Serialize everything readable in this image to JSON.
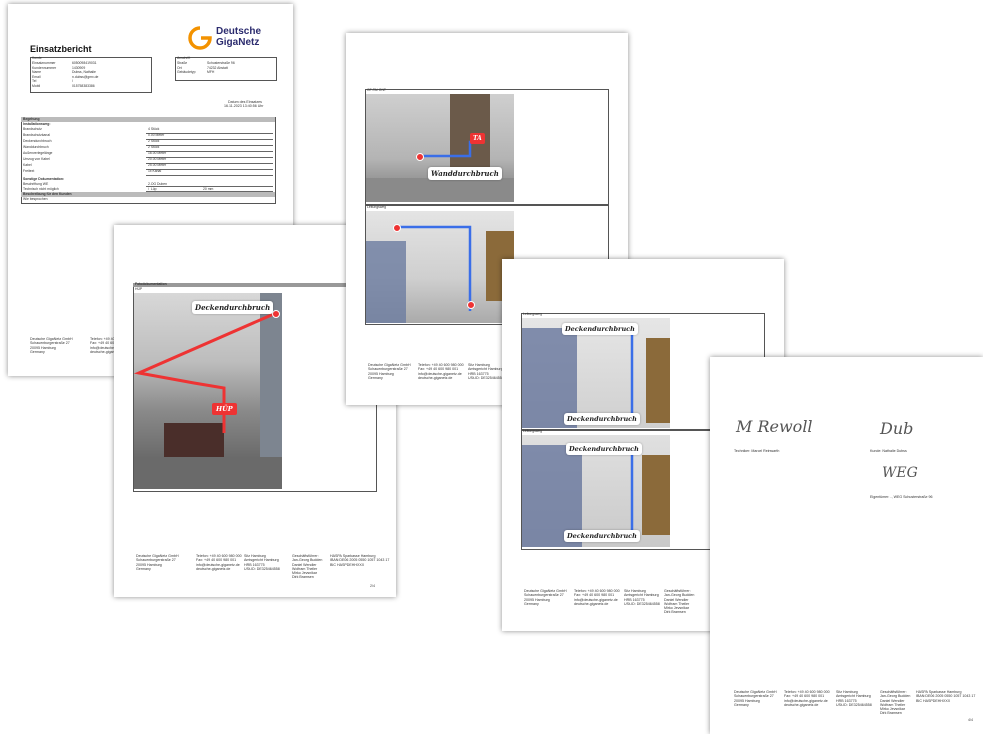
{
  "p1": {
    "title": "Einsatzbericht",
    "logo_line1": "Deutsche",
    "logo_line2": "GigaNetz",
    "kunde_head": "Kunde",
    "kunde_rows": [
      [
        "Einsatznummer",
        "6050098419031"
      ],
      [
        "Kundennummer",
        "1430909"
      ],
      [
        "Name",
        "Dubss, Nathalie"
      ],
      [
        "Email",
        "n.dubss@gmx.de"
      ],
      [
        "Tel",
        "/"
      ],
      [
        "Mobil",
        "015758383386"
      ]
    ],
    "anschrift_head": "Anschrift",
    "anschrift_rows": [
      [
        "Straße",
        "Schusterstraße 96"
      ],
      [
        "Ort",
        "74232 Abstatt"
      ],
      [
        "Gebäudetyp",
        "MFH"
      ]
    ],
    "datum_label": "Datum des Einsatzes",
    "datum_value": "16.11.2023 13:40:56 Uhr",
    "begehung": "Begehung",
    "install_head": "Installationsweg:",
    "install_rows": [
      [
        "Brandschutz",
        "4 Stück"
      ],
      [
        "Brandschutzkanal",
        "0.00 Meter"
      ],
      [
        "Deckendurchbruch",
        "2 Stück"
      ],
      [
        "Wanddurchbruch",
        "2 Stück"
      ],
      [
        "Außenverlegelänge",
        "16.00 Meter"
      ],
      [
        "Umzug von Kabel",
        "20.00 Meter"
      ],
      [
        "Kabel",
        "25.00 Meter"
      ],
      [
        "Freitext",
        "1x Kanal"
      ]
    ],
    "sonst_head": "Sonstige Dokumentation:",
    "sonst_rows": [
      [
        "Beschriftung WE",
        "2.OG Duben"
      ],
      [
        "Technisch nicht möglich",
        "/  Lüp",
        "20 mm"
      ]
    ],
    "besch_head": "Beschreibung für den Kunden",
    "besch_text": "Wie besprochen",
    "footer_col1": "Deutsche GigaNetz GmbH\nSchauenburgerstraße 27\n20095 Hamburg\nGermany",
    "footer_col2": "Telefon: +49 40 600 980 000\nFax: +49 40 600 980 001\ninfo@deutsche-giganetz.de\ndeutsche-giganetz.de"
  },
  "p2": {
    "section": "Fotodokumentation",
    "caption": "HÜP",
    "label_decke": "Deckendurchbruch",
    "label_huep": "HÜP",
    "footer_col1": "Deutsche GigaNetz GmbH\nSchauenburgerstraße 27\n20095 Hamburg\nGermany",
    "footer_col2": "Telefon: +49 40 600 980 000\nFax: +49 40 600 980 001\ninfo@deutsche-giganetz.de\ndeutsche-giganetz.de",
    "footer_col3": "Sitz Hamburg\nAmtsgericht Hamburg\nHRB 163775\nUSt-ID: DE325464558",
    "footer_col4": "Geschäftsführer:\nJan-Georg Budden\nDaniel Wendler\nWolfram Theiler\nMirko Jevsnikar\nDirk Bramsen",
    "footer_col5": "HASPA Sparkasse Hamburg\nIBAN:DE06 2005 0550 1057 1043 17\nBIC HASPDEHHXXX",
    "page": "2/4"
  },
  "p3": {
    "caption1": "GF-TA/ ONT",
    "label_wand": "Wanddurchbruch",
    "label_ta": "TA",
    "caption2": "Leitungsweg",
    "footer_col1": "Deutsche GigaNetz GmbH\nSchauenburgerstraße 27\n20095 Hamburg\nGermany",
    "footer_col2": "Telefon: +49 40 600 980 000\nFax: +49 40 600 980 001\ninfo@deutsche-giganetz.de\ndeutsche-giganetz.de",
    "footer_col3": "Sitz Hamburg\nAmtsgericht Hamburg\nHRB 163775\nUSt-ID: DE325464558"
  },
  "p4": {
    "caption1": "Leitungsweg",
    "label_d1": "Deckendurchbruch",
    "label_d2": "Deckendurchbruch",
    "caption2": "Leitungsweg",
    "label_d3": "Deckendurchbruch",
    "label_d4": "Deckendurchbruch",
    "footer_col1": "Deutsche GigaNetz GmbH\nSchauenburgerstraße 27\n20095 Hamburg\nGermany",
    "footer_col2": "Telefon: +49 40 600 980 000\nFax: +49 40 600 980 001\ninfo@deutsche-giganetz.de\ndeutsche-giganetz.de",
    "footer_col3": "Sitz Hamburg\nAmtsgericht Hamburg\nHRB 163775\nUSt-ID: DE325464558",
    "footer_col4": "Geschäftsführer:\nJan-Georg Budden\nDaniel Wendler\nWolfram Theiler\nMirko Jevsnikar\nDirk Bramsen"
  },
  "p5": {
    "sig_tech": "M Rewoll",
    "tech_label": "Techniker: Marcel Reinwarth",
    "sig_kunde": "Dub",
    "kunde_label": "Kunde: Nathalie Dubss",
    "sig_eig": "WEG",
    "eig_label": "Eigentümer: -, WEG Schusterstraße 96",
    "footer_col1": "Deutsche GigaNetz GmbH\nSchauenburgerstraße 27\n20095 Hamburg\nGermany",
    "footer_col2": "Telefon: +49 40 600 980 000\nFax: +49 40 600 980 001\ninfo@deutsche-giganetz.de\ndeutsche-giganetz.de",
    "footer_col3": "Sitz Hamburg\nAmtsgericht Hamburg\nHRB 163775\nUSt-ID: DE325464558",
    "footer_col4": "Geschäftsführer:\nJan-Georg Budden\nDaniel Wendler\nWolfram Theiler\nMirko Jevsnikar\nDirk Bramsen",
    "footer_col5": "HASPA Sparkasse Hamburg\nIBAN:DE06 2005 0550 1057 1043 17\nBIC HASPDEHHXXX",
    "page": "4/4"
  },
  "colors": {
    "brand_orange": "#f39200",
    "brand_text": "#2b2b6e",
    "marker_red": "#e33333",
    "route_blue": "#3a6ee8",
    "header_gray": "#bbbbbb"
  }
}
